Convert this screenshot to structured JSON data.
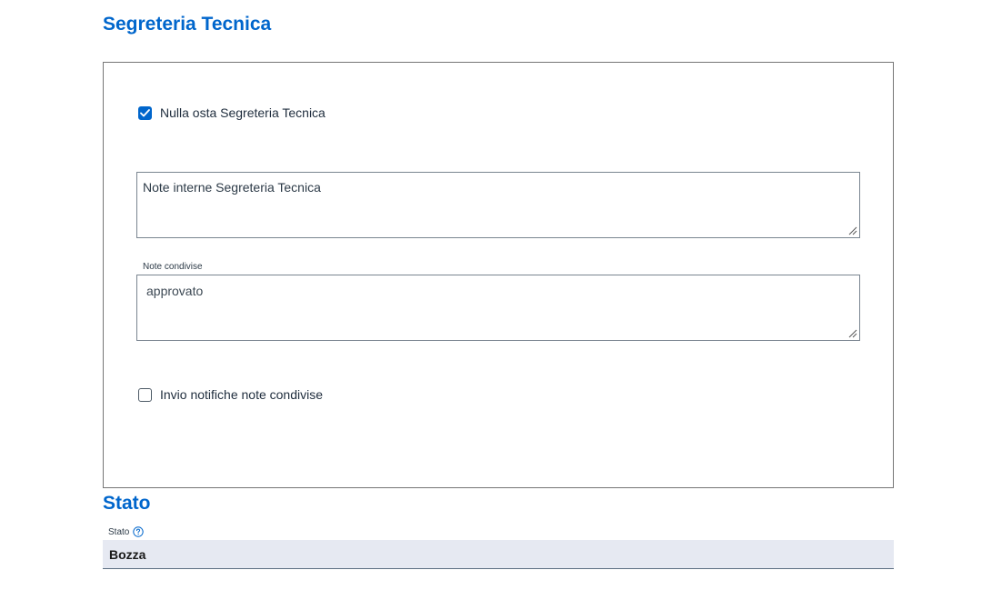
{
  "sections": {
    "segreteria_title": "Segreteria Tecnica",
    "stato_title": "Stato"
  },
  "form": {
    "nulla_osta": {
      "label": "Nulla osta Segreteria Tecnica",
      "checked": true
    },
    "note_interne": {
      "placeholder": "Note interne Segreteria Tecnica",
      "value": ""
    },
    "note_condivise": {
      "label": "Note condivise",
      "value": "approvato"
    },
    "invio_notifiche": {
      "label": "Invio notifiche note condivise",
      "checked": false
    }
  },
  "stato": {
    "label": "Stato",
    "value": "Bozza",
    "help_icon": "question-circle-icon"
  },
  "colors": {
    "accent": "#0066cc",
    "stato_bg": "#e6e9f2"
  }
}
